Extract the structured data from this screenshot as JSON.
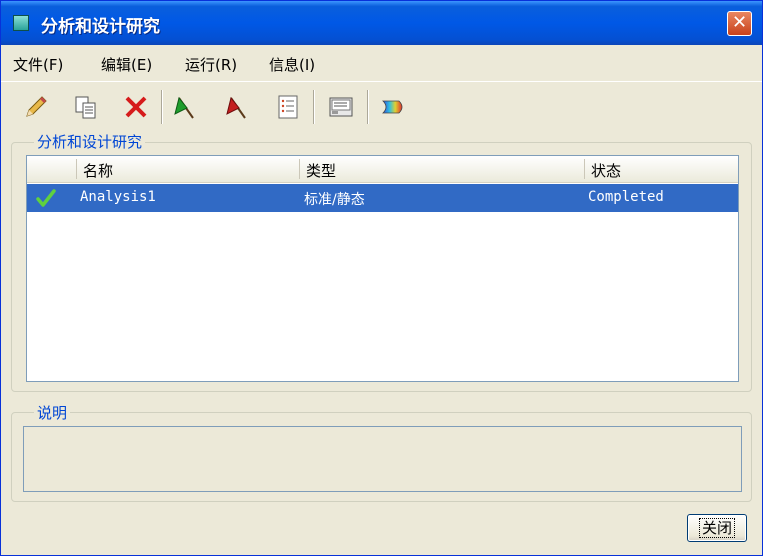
{
  "window": {
    "title": "分析和设计研究",
    "close_glyph": "✕"
  },
  "menu": [
    {
      "label": "文件(F)"
    },
    {
      "label": "编辑(E)"
    },
    {
      "label": "运行(R)"
    },
    {
      "label": "信息(I)"
    }
  ],
  "toolbar": {
    "icons": [
      "pencil-edit-icon",
      "copy-icon",
      "delete-icon",
      "green-flag-icon",
      "red-flag-icon",
      "list-icon",
      "report-icon",
      "animation-icon"
    ]
  },
  "studies_group": {
    "label": "分析和设计研究",
    "columns": [
      "名称",
      "类型",
      "状态"
    ],
    "rows": [
      {
        "status_icon": "check-icon",
        "name": "Analysis1",
        "type": "标准/静态",
        "status": "Completed"
      }
    ]
  },
  "description_group": {
    "label": "说明",
    "value": ""
  },
  "buttons": {
    "close_label": "关闭"
  },
  "colors": {
    "title_bar": "#0058e6",
    "selection": "#316ac5",
    "group_label": "#0046d5"
  }
}
